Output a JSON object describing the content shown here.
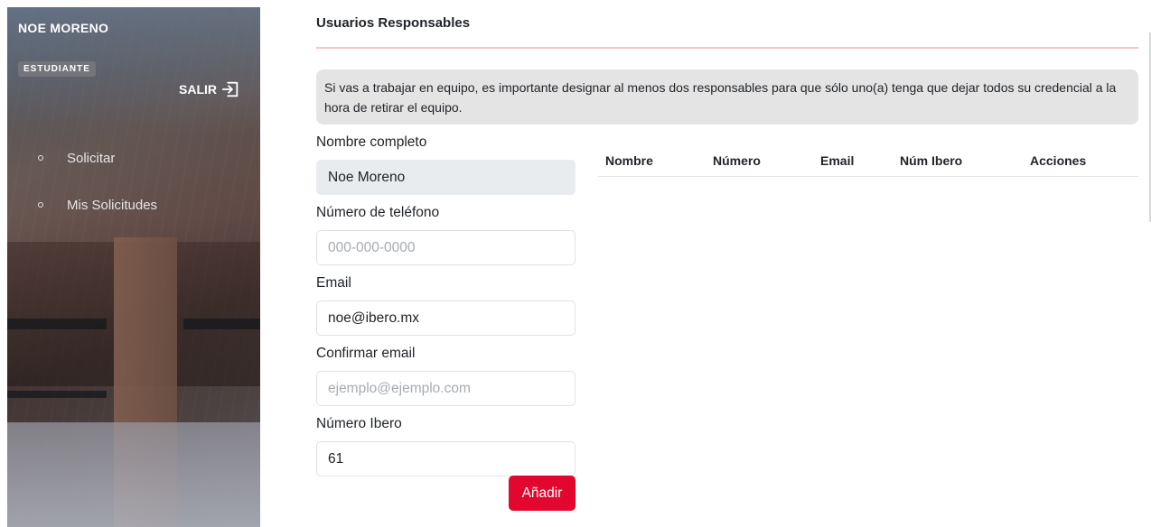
{
  "sidebar": {
    "user_name": "NOE MORENO",
    "role": "ESTUDIANTE",
    "logout_label": "SALIR",
    "items": [
      {
        "label": "Solicitar"
      },
      {
        "label": "Mis Solicitudes"
      }
    ]
  },
  "main": {
    "section_title": "Usuarios Responsables",
    "info_text": "Si vas a trabajar en equipo, es importante designar al menos dos responsables para que sólo uno(a) tenga que dejar todos su credencial a la hora de retirar el equipo.",
    "form": {
      "full_name": {
        "label": "Nombre completo",
        "value": "Noe Moreno"
      },
      "phone": {
        "label": "Número de teléfono",
        "placeholder": "000-000-0000",
        "value": ""
      },
      "email": {
        "label": "Email",
        "value": "noe@ibero.mx"
      },
      "confirm_email": {
        "label": "Confirmar email",
        "placeholder": "ejemplo@ejemplo.com",
        "value": ""
      },
      "ibero_number": {
        "label": "Número Ibero",
        "value": "61"
      },
      "add_label": "Añadir"
    },
    "table": {
      "columns": [
        "Nombre",
        "Número",
        "Email",
        "Núm Ibero",
        "Acciones"
      ],
      "rows": []
    }
  },
  "colors": {
    "accent": "#e3062f",
    "divider": "#f3c6c2",
    "info_bg": "#e4e4e4"
  }
}
